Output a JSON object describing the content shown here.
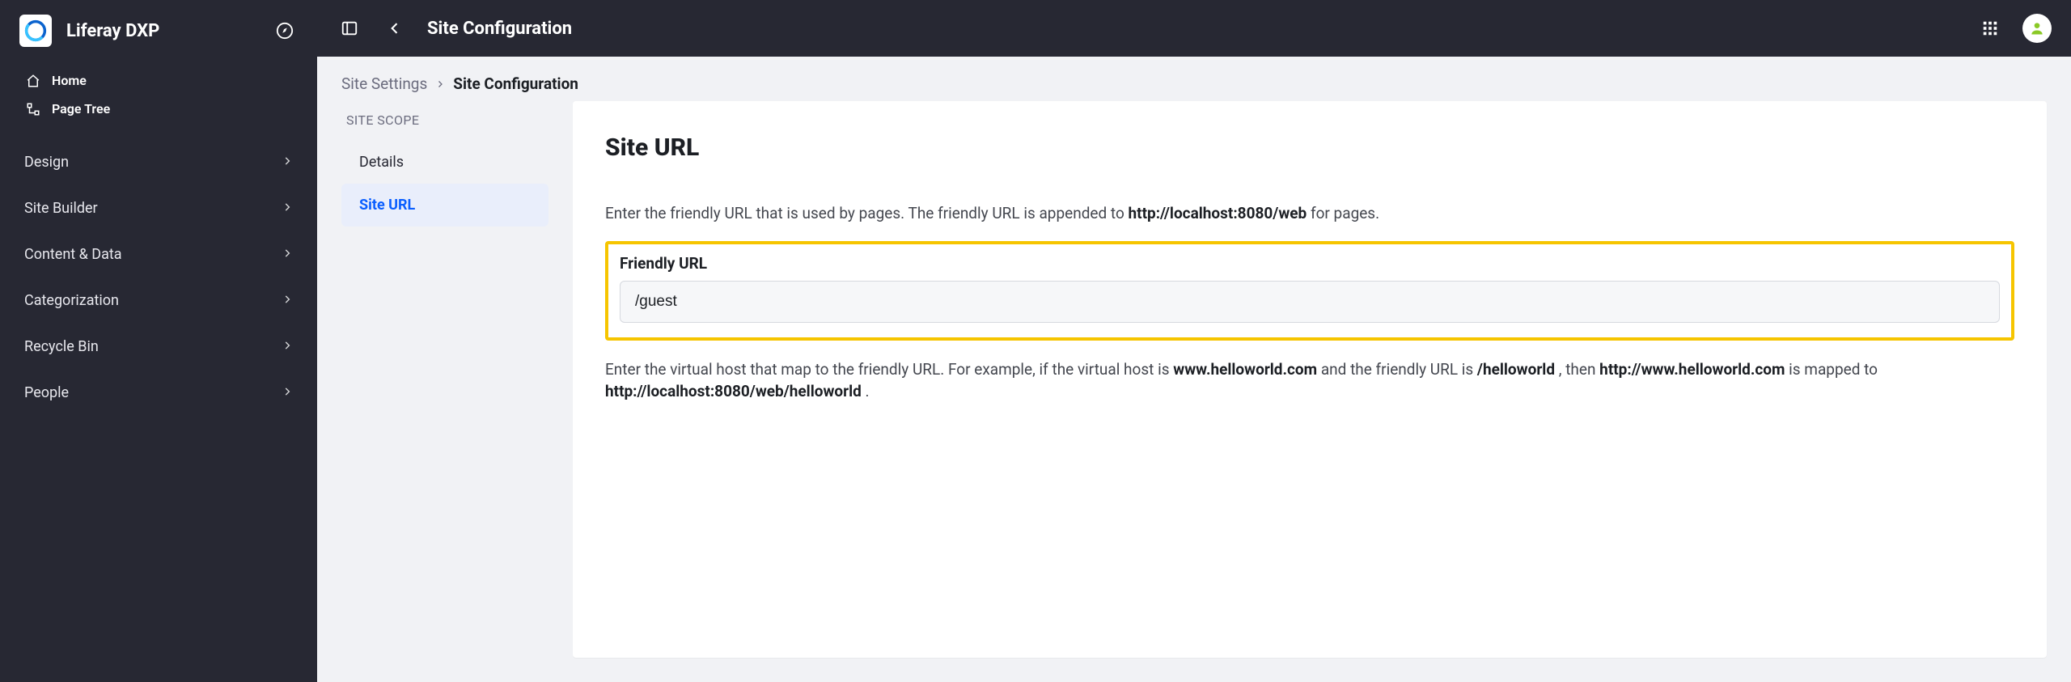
{
  "brand": {
    "title": "Liferay DXP"
  },
  "sidebar": {
    "quick": [
      {
        "label": "Home"
      },
      {
        "label": "Page Tree"
      }
    ],
    "nav": [
      {
        "label": "Design"
      },
      {
        "label": "Site Builder"
      },
      {
        "label": "Content & Data"
      },
      {
        "label": "Categorization"
      },
      {
        "label": "Recycle Bin"
      },
      {
        "label": "People"
      }
    ]
  },
  "topbar": {
    "title": "Site Configuration"
  },
  "breadcrumb": {
    "parent": "Site Settings",
    "current": "Site Configuration"
  },
  "subnav": {
    "heading": "SITE SCOPE",
    "items": [
      {
        "label": "Details",
        "active": false
      },
      {
        "label": "Site URL",
        "active": true
      }
    ]
  },
  "card": {
    "title": "Site URL",
    "help1_pre": "Enter the friendly URL that is used by pages. The friendly URL is appended to ",
    "help1_bold": "http://localhost:8080/web",
    "help1_post": " for pages.",
    "field_label": "Friendly URL",
    "field_value": "/guest",
    "help2_a": "Enter the virtual host that map to the friendly URL. For example, if the virtual host is ",
    "help2_b": "www.helloworld.com",
    "help2_c": " and the friendly URL is ",
    "help2_d": "/helloworld",
    "help2_e": ", then ",
    "help2_f": "http://www.helloworld.com",
    "help2_g": " is mapped to ",
    "help2_h": "http://localhost:8080/web/helloworld",
    "help2_i": "."
  }
}
